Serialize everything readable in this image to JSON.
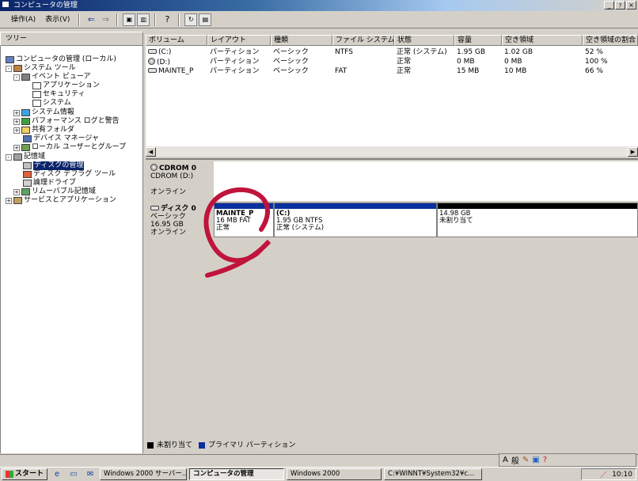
{
  "window": {
    "title": "コンピュータの管理",
    "buttons": [
      "_",
      "ｧ",
      "×"
    ]
  },
  "menu": {
    "action": "操作(A)",
    "view": "表示(V)"
  },
  "toolbar": {
    "icons": [
      "back-arrow-icon",
      "forward-arrow-icon",
      "up-folder-icon",
      "show-tree-icon",
      "help-icon",
      "refresh-icon",
      "properties-icon"
    ]
  },
  "tree": {
    "header": "ツリー",
    "nodes": [
      "コンピュータの管理 (ローカル)",
      "システム ツール",
      "イベント ビューア",
      "アプリケーション",
      "セキュリティ",
      "システム",
      "システム情報",
      "パフォーマンス ログと警告",
      "共有フォルダ",
      "デバイス マネージャ",
      "ローカル ユーザーとグループ",
      "記憶域",
      "ディスクの管理",
      "ディスク デフラグ ツール",
      "論理ドライブ",
      "リムーバブル記憶域",
      "サービスとアプリケーション"
    ]
  },
  "volumes": {
    "columns": [
      "ボリューム",
      "レイアウト",
      "種類",
      "ファイル システム",
      "状態",
      "容量",
      "空き領域",
      "空き領域の割合"
    ],
    "rows": [
      [
        "(C:)",
        "パーティション",
        "ベーシック",
        "NTFS",
        "正常 (システム)",
        "1.95 GB",
        "1.02 GB",
        "52 %"
      ],
      [
        "(D:)",
        "パーティション",
        "ベーシック",
        "",
        "正常",
        "0 MB",
        "0 MB",
        "100 %"
      ],
      [
        "MAINTE_P",
        "パーティション",
        "ベーシック",
        "FAT",
        "正常",
        "15 MB",
        "10 MB",
        "66 %"
      ]
    ]
  },
  "cdrom": {
    "title": "CDROM 0",
    "sub": "CDROM (D:)",
    "status": "オンライン"
  },
  "disk0": {
    "title": "ディスク 0",
    "type": "ベーシック",
    "size": "16.95 GB",
    "status": "オンライン",
    "partitions": [
      {
        "name": "MAINTE_P",
        "line2": "16 MB FAT",
        "line3": "正常"
      },
      {
        "name": "(C:)",
        "line2": "1.95 GB NTFS",
        "line3": "正常 (システム)"
      },
      {
        "name": "",
        "line2": "14.98 GB",
        "line3": "未割り当て"
      }
    ]
  },
  "legend": {
    "unallocated": "未割り当て",
    "primary": "プライマリ パーティション"
  },
  "ime": {
    "a": "A",
    "mode": "般"
  },
  "taskbar": {
    "start": "スタート",
    "tasks": [
      "Windows 2000 サーバー...",
      "コンピュータの管理",
      "Windows 2000",
      "C:¥WINNT¥System32¥c..."
    ],
    "clock": "10:10"
  },
  "colors": {
    "primary": "#0a2f9e",
    "unallocated": "#000000",
    "highlight": "#c0143c"
  }
}
